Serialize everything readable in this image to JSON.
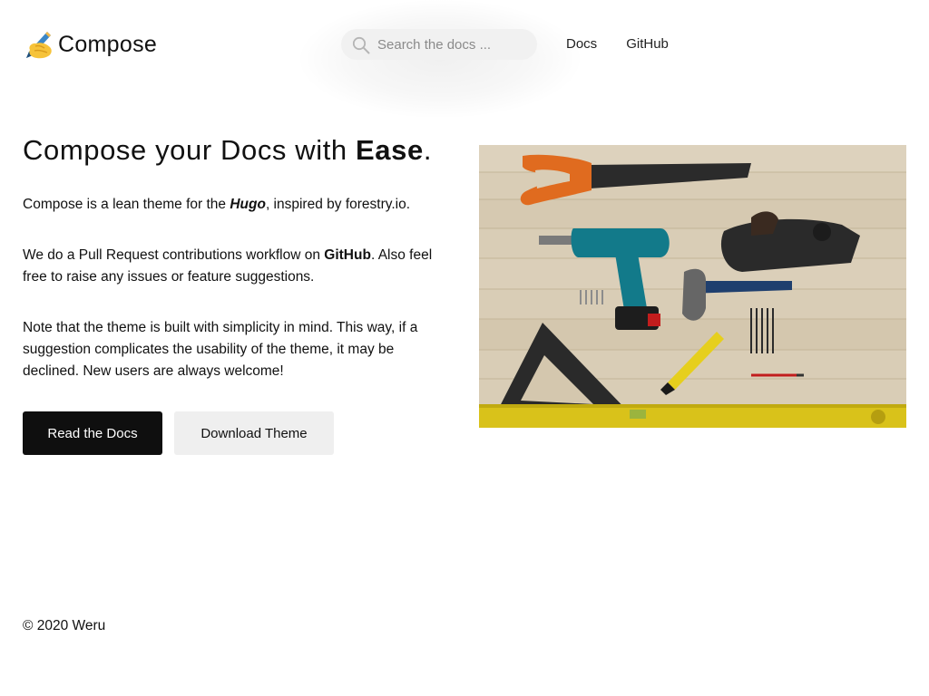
{
  "header": {
    "logo_emoji": "✍️",
    "logo_text": "Compose",
    "search_placeholder": "Search the docs ...",
    "nav": [
      {
        "label": "Docs"
      },
      {
        "label": "GitHub"
      }
    ]
  },
  "hero": {
    "title_prefix": "Compose your Docs with ",
    "title_emphasis": "Ease",
    "title_suffix": ".",
    "p1_pre": "Compose is a lean theme for the ",
    "p1_em": "Hugo",
    "p1_post": ", inspired by forestry.io.",
    "p2_pre": "We do a Pull Request contributions workflow on ",
    "p2_strong": "GitHub",
    "p2_post": ". Also feel free to raise any issues or feature suggestions.",
    "p3": "Note that the theme is built with simplicity in mind. This way, if a suggestion complicates the usability of the theme, it may be declined. New users are always welcome!",
    "primary_button": "Read the Docs",
    "secondary_button": "Download Theme"
  },
  "footer": {
    "copyright": "© 2020 Weru"
  },
  "colors": {
    "primary_button_bg": "#0f0f0f",
    "secondary_button_bg": "#efefef",
    "search_bg": "#f1f1f1",
    "wood_bg": "#d9cdb6",
    "level_yellow": "#d9c21a",
    "saw_handle": "#e06b1f",
    "drill_teal": "#127a8a"
  },
  "icons": {
    "logo": "writing-hand-icon",
    "search": "search-icon"
  }
}
